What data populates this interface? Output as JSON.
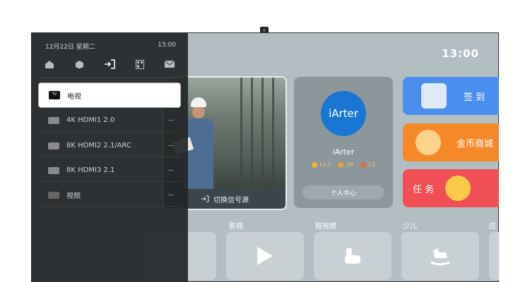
{
  "status": {
    "clock": "13:00"
  },
  "panel": {
    "date": "12月22日 星期二",
    "time": "13:00",
    "icons": [
      "home-icon",
      "cube-icon",
      "input-source-icon",
      "apps-icon",
      "mail-icon"
    ],
    "sources": [
      {
        "label": "电视",
        "icon": "tv-icon"
      },
      {
        "label": "4K HDMI1 2.0",
        "icon": "hdmi-icon"
      },
      {
        "label": "8K HDMI2 2.1/ARC",
        "icon": "hdmi-icon"
      },
      {
        "label": "8K HDMI3 2.1",
        "icon": "hdmi-icon"
      },
      {
        "label": "视频",
        "icon": "av-icon"
      }
    ],
    "active_source": "电视"
  },
  "video_card": {
    "switch_label": "切换信号源"
  },
  "profile": {
    "avatar_text": "iArter",
    "name": "iArter",
    "level": "Lv.1",
    "coins": "39",
    "points": "23",
    "center_button": "个人中心"
  },
  "tiles": {
    "checkin": "签 到",
    "coins_mall": "金币商城",
    "tasks": "任 务"
  },
  "categories": [
    "影视",
    "短视频",
    "少儿",
    "应"
  ],
  "colors": {
    "checkin": "#4a8ef0",
    "coins": "#f5892a",
    "tasks": "#f04f55",
    "avatar": "#1976d2"
  }
}
